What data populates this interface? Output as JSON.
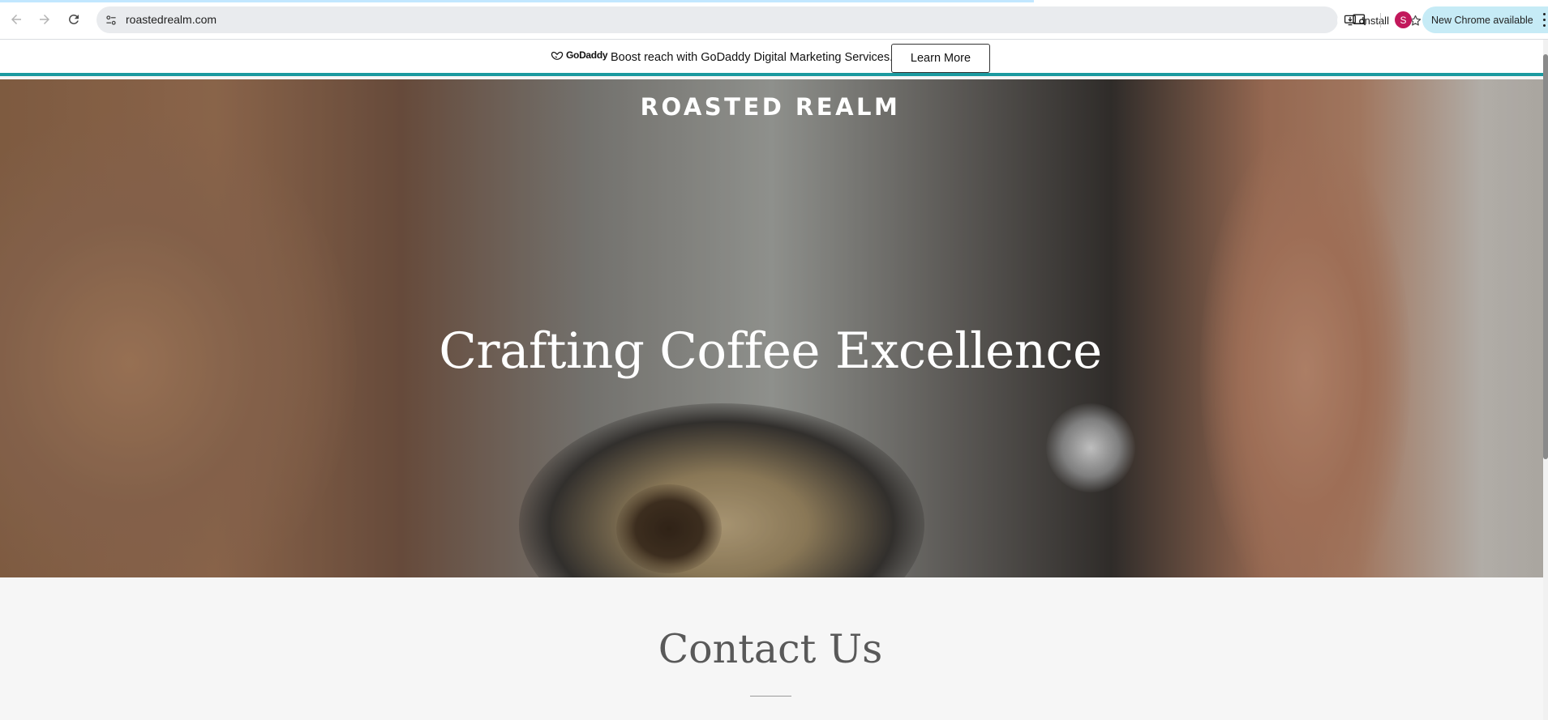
{
  "browser": {
    "url": "roastedrealm.com",
    "install_label": "Install",
    "update_label": "New Chrome available",
    "profile_initial": "S",
    "icons": [
      "back-arrow-icon",
      "forward-arrow-icon",
      "reload-icon",
      "site-settings-icon",
      "install-app-icon",
      "bookmark-star-icon",
      "tab-search-icon",
      "more-menu-icon"
    ]
  },
  "promo": {
    "logo_text": "GoDaddy",
    "message": "Boost reach with GoDaddy Digital Marketing Services.",
    "button_label": "Learn More",
    "accent_color": "#1b9aa0"
  },
  "hero": {
    "brand": "ROASTED REALM",
    "title": "Crafting Coffee Excellence"
  },
  "contact": {
    "heading": "Contact Us"
  }
}
